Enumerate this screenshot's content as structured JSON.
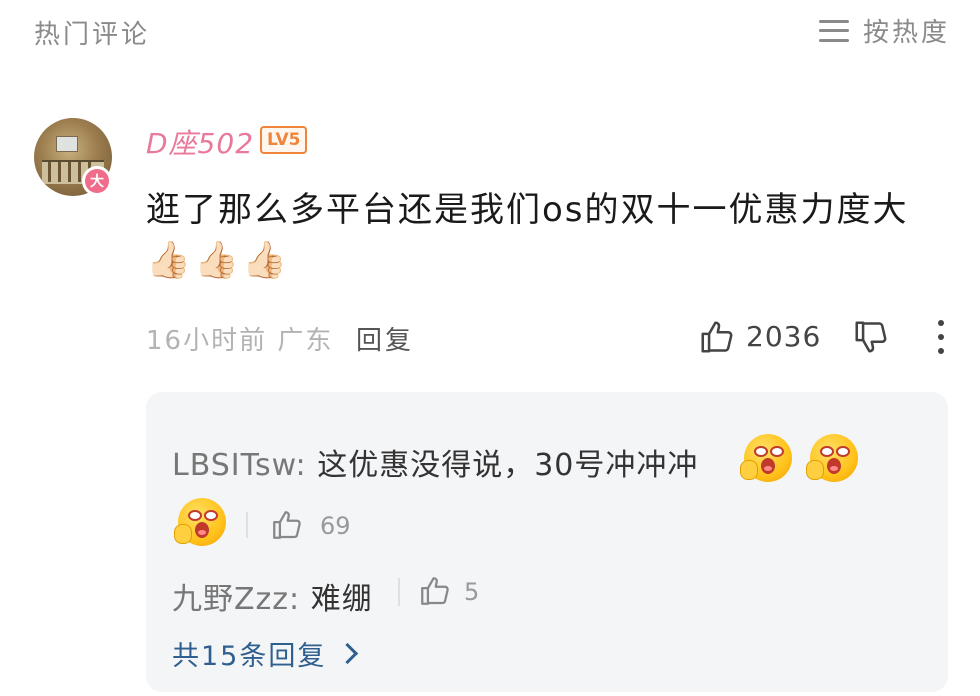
{
  "header": {
    "title": "热门评论",
    "sort_label": "按热度",
    "sort_icon": "menu-icon"
  },
  "comment": {
    "avatar_badge": "大",
    "username": "D座502",
    "level": "LV5",
    "text": "逛了那么多平台还是我们os的双十一优惠力度大",
    "emojis": [
      "👍🏻",
      "👍🏻",
      "👍🏻"
    ],
    "time": "16小时前",
    "location": "广东",
    "reply_label": "回复",
    "like_count": "2036"
  },
  "replies": [
    {
      "user": "LBSITsw:",
      "text": " 这优惠没得说，30号冲冲冲",
      "like_count": "69"
    },
    {
      "user": "九野Zzz:",
      "text": " 难绷",
      "like_count": "5"
    }
  ],
  "more_replies_label": "共15条回复",
  "colors": {
    "username": "#e8799a",
    "level": "#f0843a",
    "link": "#2f5f8e",
    "reply_bg": "#f4f5f7"
  }
}
